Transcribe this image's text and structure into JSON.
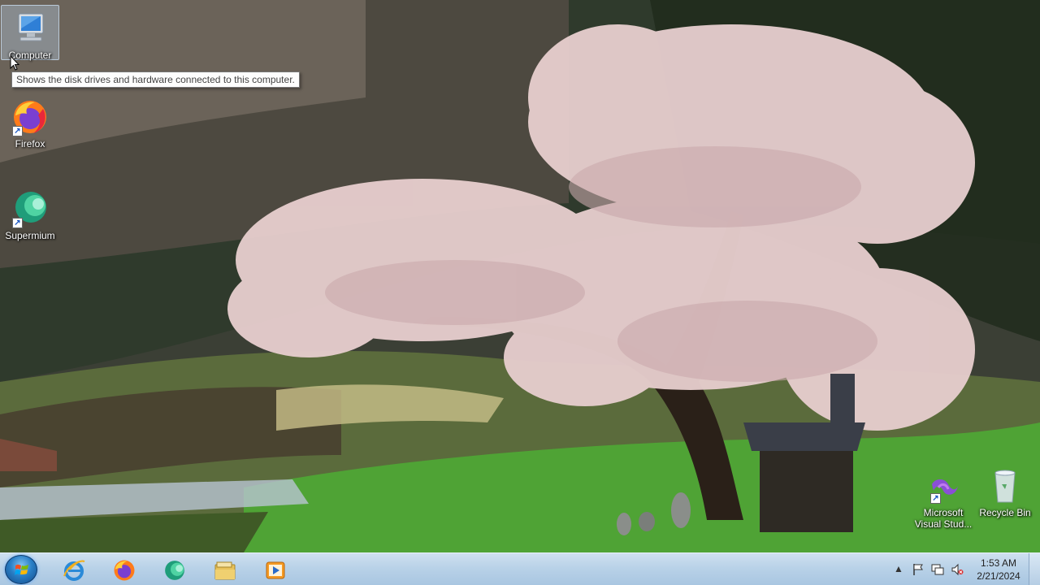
{
  "desktop": {
    "icons": [
      {
        "label": "Computer"
      },
      {
        "label": "Firefox"
      },
      {
        "label": "Supermium"
      },
      {
        "label": "Microsoft Visual Stud..."
      },
      {
        "label": "Recycle Bin"
      }
    ],
    "tooltip": "Shows the disk drives and hardware connected to this computer."
  },
  "taskbar": {
    "pinned": [
      {
        "icon": "internet-explorer-icon"
      },
      {
        "icon": "firefox-icon"
      },
      {
        "icon": "supermium-icon"
      },
      {
        "icon": "file-explorer-icon"
      },
      {
        "icon": "media-player-icon"
      }
    ],
    "tray": {
      "icons": [
        "show-hidden-icons-icon",
        "action-center-flag-icon",
        "network-icon",
        "volume-muted-icon"
      ]
    },
    "clock": {
      "time": "1:53 AM",
      "date": "2/21/2024"
    }
  },
  "colors": {
    "taskbar": "#b9d2e8",
    "tooltip_bg": "#fdfdfd",
    "start_orb": "#2a7fc6"
  }
}
